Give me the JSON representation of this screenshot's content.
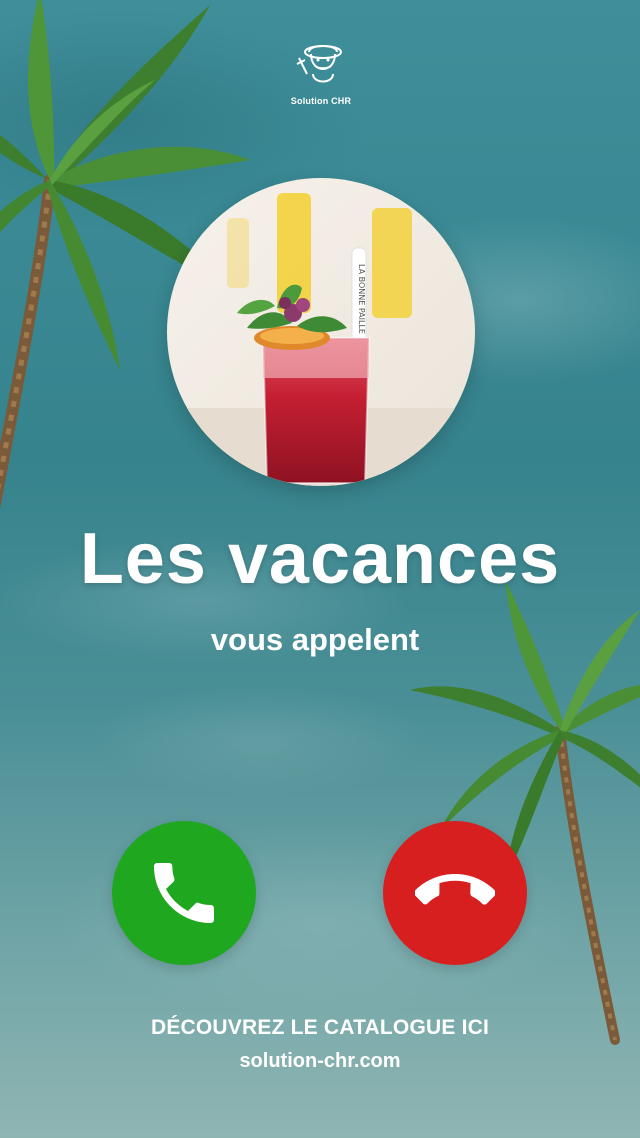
{
  "logo": {
    "text": "Solution CHR"
  },
  "avatar": {
    "straw_text": "LA BONNE PAILLE"
  },
  "main": {
    "title": "Les vacances",
    "subtitle": "vous appelent"
  },
  "actions": {
    "accept_icon": "phone-accept-icon",
    "decline_icon": "phone-decline-icon"
  },
  "footer": {
    "cta": "DÉCOUVREZ LE CATALOGUE ICI",
    "url": "solution-chr.com"
  },
  "colors": {
    "accept": "#1fa81f",
    "decline": "#d81f1f",
    "text": "#ffffff"
  }
}
